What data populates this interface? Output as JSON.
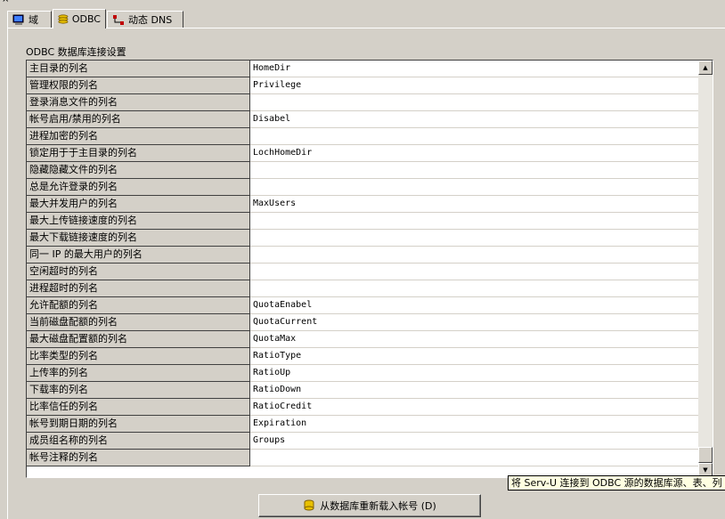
{
  "tabs": [
    {
      "label": "域",
      "icon": "computer-icon"
    },
    {
      "label": "ODBC",
      "icon": "database-coins-icon"
    },
    {
      "label": "动态 DNS",
      "icon": "dns-network-icon"
    }
  ],
  "group_title": "ODBC 数据库连接设置",
  "rows": [
    {
      "label": "主目录的列名",
      "value": "HomeDir"
    },
    {
      "label": "管理权限的列名",
      "value": "Privilege"
    },
    {
      "label": "登录消息文件的列名",
      "value": ""
    },
    {
      "label": "帐号启用/禁用的列名",
      "value": "Disabel"
    },
    {
      "label": "进程加密的列名",
      "value": ""
    },
    {
      "label": "锁定用于于主目录的列名",
      "value": "LochHomeDir"
    },
    {
      "label": "隐藏隐藏文件的列名",
      "value": ""
    },
    {
      "label": "总是允许登录的列名",
      "value": ""
    },
    {
      "label": "最大并发用户的列名",
      "value": "MaxUsers"
    },
    {
      "label": "最大上传链接速度的列名",
      "value": ""
    },
    {
      "label": "最大下载链接速度的列名",
      "value": ""
    },
    {
      "label": "同一 IP 的最大用户的列名",
      "value": ""
    },
    {
      "label": "空闲超时的列名",
      "value": ""
    },
    {
      "label": "进程超时的列名",
      "value": ""
    },
    {
      "label": "允许配额的列名",
      "value": "QuotaEnabel"
    },
    {
      "label": "当前磁盘配额的列名",
      "value": "QuotaCurrent"
    },
    {
      "label": "最大磁盘配置额的列名",
      "value": "QuotaMax"
    },
    {
      "label": "比率类型的列名",
      "value": "RatioType"
    },
    {
      "label": "上传率的列名",
      "value": "RatioUp"
    },
    {
      "label": "下载率的列名",
      "value": "RatioDown"
    },
    {
      "label": "比率信任的列名",
      "value": "RatioCredit"
    },
    {
      "label": "帐号到期日期的列名",
      "value": "Expiration"
    },
    {
      "label": "成员组名称的列名",
      "value": "Groups"
    },
    {
      "label": "帐号注释的列名",
      "value": ""
    }
  ],
  "tooltip": "将 Serv-U 连接到 ODBC 源的数据库源、表、列",
  "reload_button": {
    "label": "从数据库重新载入帐号 (D)",
    "icon": "database-reload-icon"
  },
  "colors": {
    "face": "#d4d0c8",
    "tooltip_bg": "#ffffe1",
    "grid_bg": "#ffffff"
  }
}
